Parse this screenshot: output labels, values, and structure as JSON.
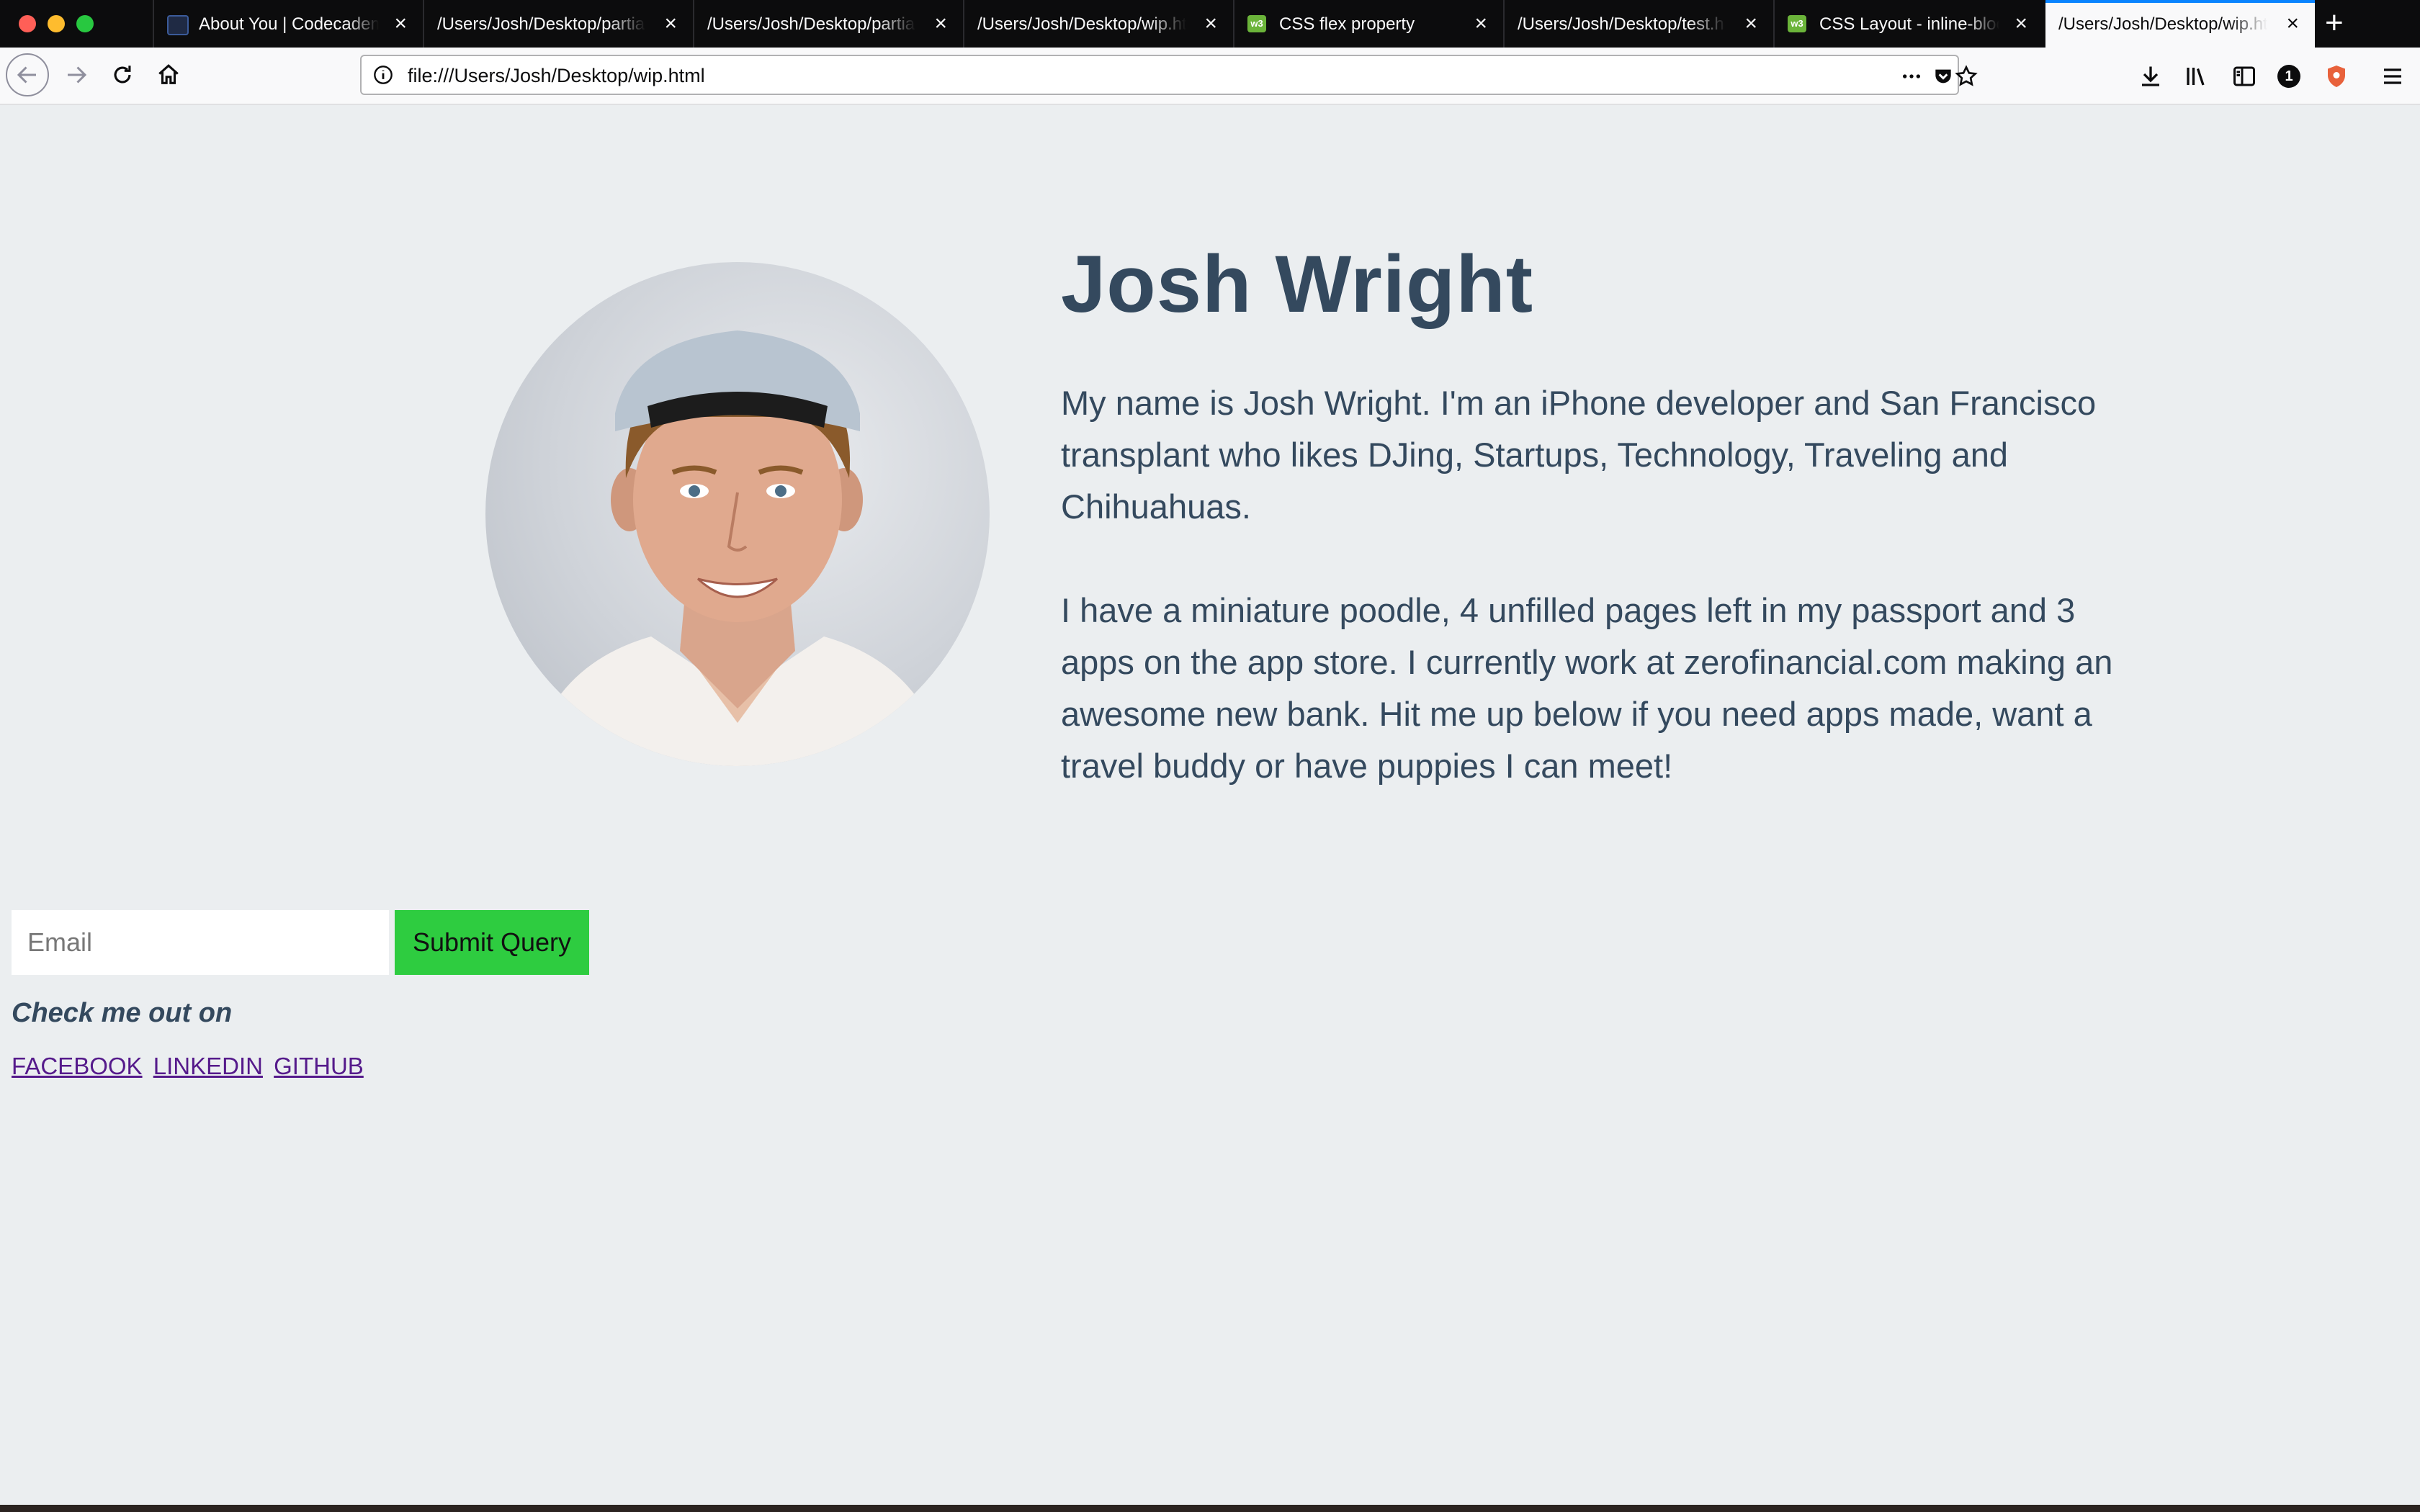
{
  "browser": {
    "tabs": [
      {
        "title": "About You | Codecadem",
        "icon": "codecademy-icon",
        "active": false
      },
      {
        "title": "/Users/Josh/Desktop/partial",
        "icon": "",
        "active": false
      },
      {
        "title": "/Users/Josh/Desktop/partial",
        "icon": "",
        "active": false
      },
      {
        "title": "/Users/Josh/Desktop/wip.ht",
        "icon": "",
        "active": false
      },
      {
        "title": "CSS flex property",
        "icon": "w3schools-icon",
        "active": false
      },
      {
        "title": "/Users/Josh/Desktop/test.h",
        "icon": "",
        "active": false
      },
      {
        "title": "CSS Layout - inline-bloc",
        "icon": "w3schools-icon",
        "active": false
      },
      {
        "title": "/Users/Josh/Desktop/wip.ht",
        "icon": "",
        "active": true
      }
    ],
    "url": "file:///Users/Josh/Desktop/wip.html",
    "badge_count": "1",
    "w3_icon_text": "w3"
  },
  "page": {
    "name": "Josh Wright",
    "bio_1": "My name is Josh Wright. I'm an iPhone developer and San Francisco transplant who likes DJing, Startups, Technology, Traveling and Chihuahuas.",
    "bio_2": "I have a miniature poodle, 4 unfilled pages left in my passport and 3 apps on the app store. I currently work at zerofinancial.com making an awesome new bank. Hit me up below if you need apps made, want a travel buddy or have puppies I can meet!",
    "email_placeholder": "Email",
    "submit_label": "Submit Query",
    "check_me_out": "Check me out on",
    "links": [
      "FACEBOOK",
      "LINKEDIN",
      "GITHUB"
    ]
  },
  "colors": {
    "background": "#ebeef0",
    "text": "#34495e",
    "submit": "#2ecc40",
    "link": "#551a8b",
    "tab_accent": "#0a84ff"
  }
}
